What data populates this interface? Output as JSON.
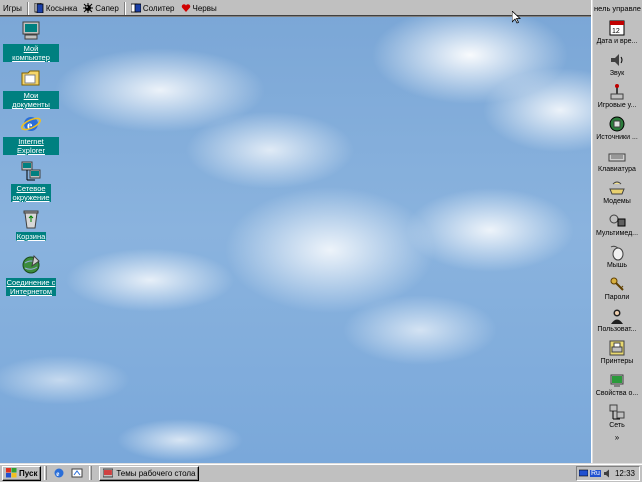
{
  "top_toolbar": {
    "items": [
      {
        "label": "Игры",
        "icon": "games-folder-icon"
      },
      {
        "label": "Косынка",
        "icon": "solitaire-icon"
      },
      {
        "label": "Сапер",
        "icon": "minesweeper-icon"
      },
      {
        "label": "Солитер",
        "icon": "freecell-icon"
      },
      {
        "label": "Червы",
        "icon": "hearts-icon"
      }
    ]
  },
  "desktop": {
    "icons": [
      {
        "label": "Мой компьютер",
        "icon": "my-computer-icon"
      },
      {
        "label": "Мои документы",
        "icon": "my-documents-icon"
      },
      {
        "label": "Internet Explorer",
        "icon": "internet-explorer-icon"
      },
      {
        "label1": "Сетевое",
        "label2": "окружение",
        "icon": "network-neighborhood-icon"
      },
      {
        "label": "Корзина",
        "icon": "recycle-bin-icon"
      },
      {
        "label1": "Соединение с",
        "label2": "Интернетом",
        "icon": "internet-connection-icon"
      }
    ]
  },
  "control_panel": {
    "title": "нель управле",
    "items": [
      {
        "label": "Дата и вре...",
        "icon": "calendar-icon"
      },
      {
        "label": "Звук",
        "icon": "sound-icon"
      },
      {
        "label": "Игровые у...",
        "icon": "joystick-icon"
      },
      {
        "label": "Источники ...",
        "icon": "odbc-icon"
      },
      {
        "label": "Клавиатура",
        "icon": "keyboard-icon"
      },
      {
        "label": "Модемы",
        "icon": "modem-icon"
      },
      {
        "label": "Мультимед...",
        "icon": "multimedia-icon"
      },
      {
        "label": "Мышь",
        "icon": "mouse-icon"
      },
      {
        "label": "Пароли",
        "icon": "keys-icon"
      },
      {
        "label": "Пользоват...",
        "icon": "users-icon"
      },
      {
        "label": "Принтеры",
        "icon": "printer-icon"
      },
      {
        "label": "Свойства о...",
        "icon": "display-properties-icon"
      },
      {
        "label": "Сеть",
        "icon": "network-icon"
      }
    ],
    "more": "»"
  },
  "taskbar": {
    "start_label": "Пуск",
    "task_button": "Темы рабочего стола",
    "tray": {
      "lang": "Ru",
      "clock": "12:33"
    }
  }
}
